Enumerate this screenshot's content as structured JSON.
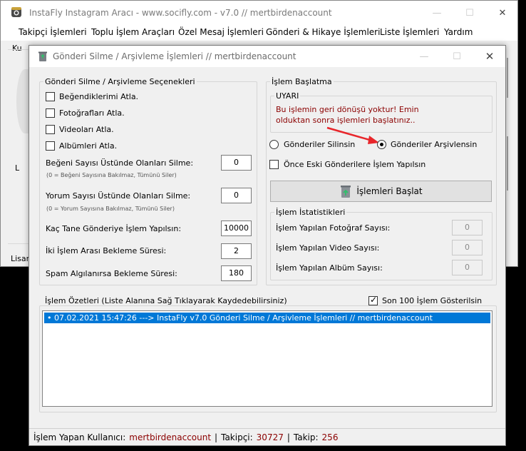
{
  "main_window": {
    "title": "InstaFly Instagram Aracı - www.socifly.com - v7.0 // mertbirdenaccount",
    "menu": [
      {
        "label": "Takipçi İşlemleri"
      },
      {
        "label": "Toplu İşlem Araçları"
      },
      {
        "label": "Özel Mesaj İşlemleri"
      },
      {
        "label": "Gönderi & Hikaye İşlemleri"
      },
      {
        "label": "Liste İşlemleri"
      },
      {
        "label": "Yardım"
      }
    ],
    "partial_labels": {
      "top": "Ku",
      "side": "L",
      "bottom": "Lisan"
    }
  },
  "dialog": {
    "title": "Gönderi Silme / Arşivleme İşlemleri // mertbirdenaccount",
    "options_group": {
      "label": "Gönderi Silme / Arşivleme Seçenekleri",
      "checkboxes": [
        {
          "label": "Beğendiklerimi Atla.",
          "checked": false
        },
        {
          "label": "Fotoğrafları Atla.",
          "checked": false
        },
        {
          "label": "Videoları Atla.",
          "checked": false
        },
        {
          "label": "Albümleri Atla.",
          "checked": false
        }
      ],
      "like_threshold": {
        "label": "Beğeni Sayısı Üstünde Olanları Silme:",
        "value": "0",
        "hint": "(0 = Beğeni Sayısına Bakılmaz, Tümünü Siler)"
      },
      "comment_threshold": {
        "label": "Yorum Sayısı Üstünde Olanları Silme:",
        "value": "0",
        "hint": "(0 = Yorum Sayısına Bakılmaz, Tümünü Siler)"
      },
      "post_count": {
        "label": "Kaç Tane Gönderiye İşlem Yapılsın:",
        "value": "10000"
      },
      "wait_time": {
        "label": "İki İşlem Arası Bekleme Süresi:",
        "value": "2"
      },
      "spam_wait": {
        "label": "Spam Algılanırsa Bekleme Süresi:",
        "value": "180"
      }
    },
    "start_group": {
      "label": "İşlem Başlatma",
      "warning": {
        "label": "UYARI",
        "text": "Bu işlemin geri dönüşü yoktur! Emin olduktan sonra işlemleri başlatınız.."
      },
      "radio_delete": {
        "label": "Gönderiler Silinsin",
        "checked": false
      },
      "radio_archive": {
        "label": "Gönderiler Arşivlensin",
        "checked": true
      },
      "oldest_first": {
        "label": "Önce Eski Gönderilere İşlem Yapılsın",
        "checked": false
      },
      "start_button": {
        "label": "İşlemleri Başlat"
      },
      "stats": {
        "label": "İşlem İstatistikleri",
        "photo": {
          "label": "İşlem Yapılan Fotoğraf Sayısı:",
          "value": "0"
        },
        "video": {
          "label": "İşlem Yapılan Video Sayısı:",
          "value": "0"
        },
        "album": {
          "label": "İşlem Yapılan Albüm Sayısı:",
          "value": "0"
        }
      }
    },
    "log_group": {
      "label": "İşlem Özetleri (Liste Alanına Sağ Tıklayarak Kaydedebilirsiniz)",
      "show_last": {
        "label": "Son 100 İşlem Gösterilsin",
        "checked": true
      },
      "entries": [
        "07.02.2021 15:47:26 ---> InstaFly v7.0 Gönderi Silme / Arşivleme İşlemleri // mertbirdenaccount"
      ]
    },
    "status_bar": {
      "user_label": "İşlem Yapan Kullanıcı:",
      "user_value": "mertbirdenaccount",
      "followers_label": "Takipçi:",
      "followers_value": "30727",
      "following_label": "Takip:",
      "following_value": "256",
      "separator": "|"
    }
  },
  "colors": {
    "accent": "#0078d7",
    "warning": "#8b0000",
    "arrow": "#e8262b"
  },
  "icons": {
    "app": "instagram-icon",
    "dialog": "recycle-bin-icon",
    "start": "recycle-bin-icon"
  }
}
